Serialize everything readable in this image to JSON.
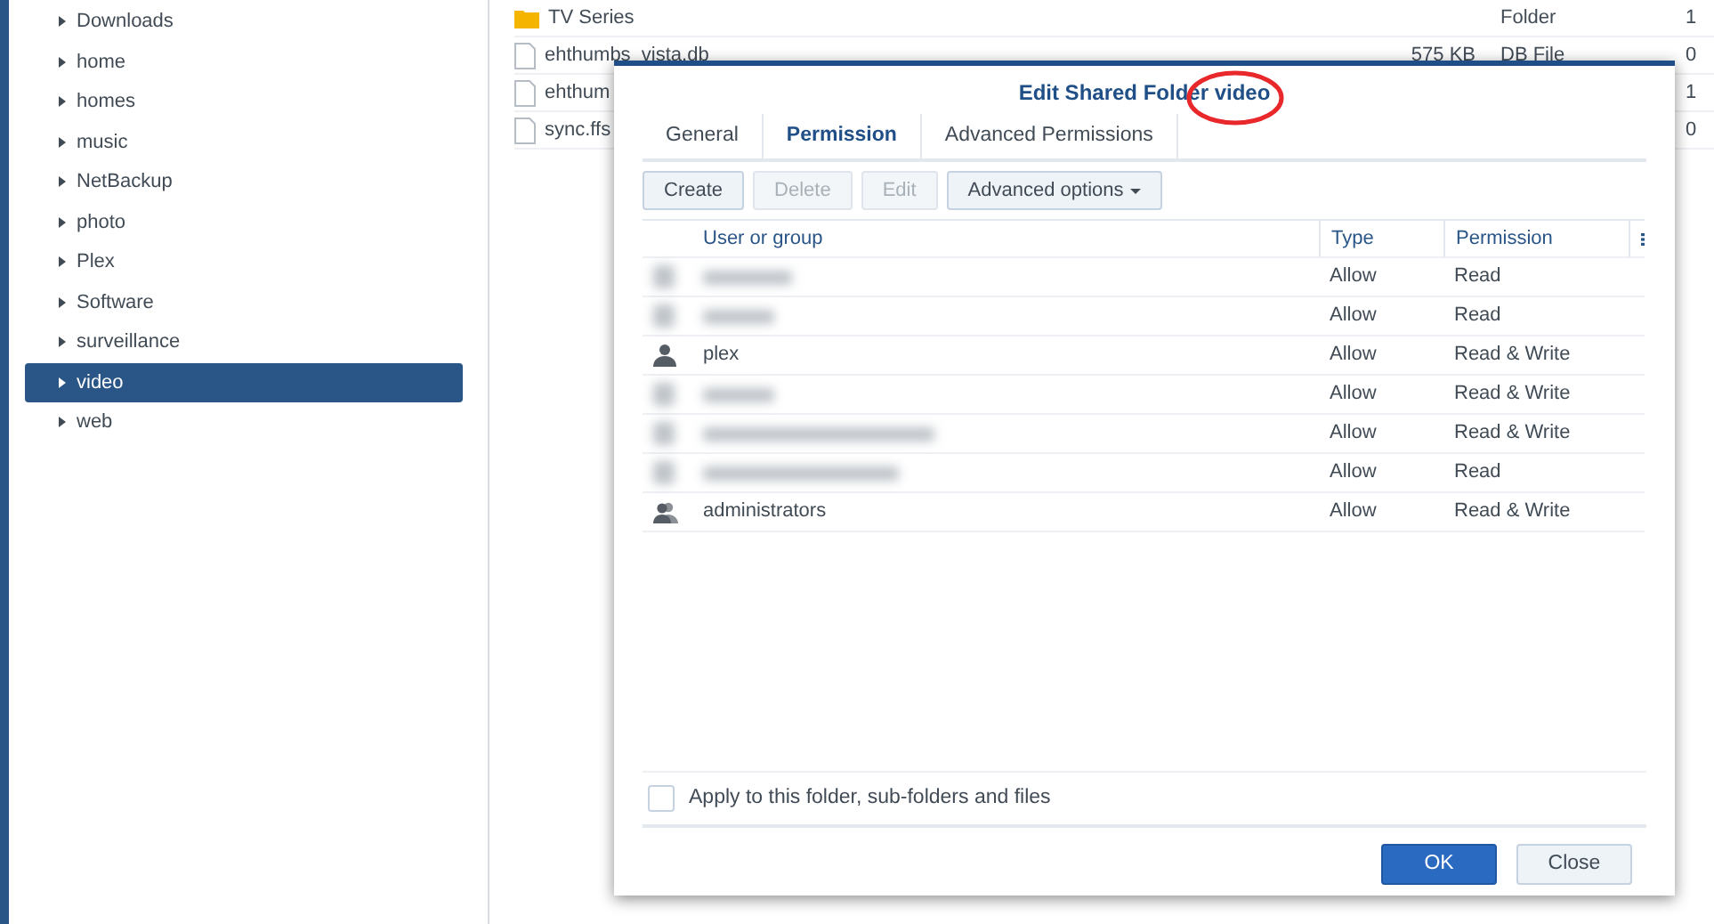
{
  "sidebar": {
    "items": [
      {
        "label": "Downloads",
        "selected": false
      },
      {
        "label": "home",
        "selected": false
      },
      {
        "label": "homes",
        "selected": false
      },
      {
        "label": "music",
        "selected": false
      },
      {
        "label": "NetBackup",
        "selected": false
      },
      {
        "label": "photo",
        "selected": false
      },
      {
        "label": "Plex",
        "selected": false
      },
      {
        "label": "Software",
        "selected": false
      },
      {
        "label": "surveillance",
        "selected": false
      },
      {
        "label": "video",
        "selected": true
      },
      {
        "label": "web",
        "selected": false
      }
    ]
  },
  "files": [
    {
      "kind": "folder",
      "name": "TV Series",
      "type": "Folder",
      "column_4": "1"
    },
    {
      "kind": "file",
      "name": "ehthumbs_vista.db",
      "size": "575 KB",
      "type": "DB File",
      "column_4": "0"
    },
    {
      "kind": "file",
      "name": "ehthum",
      "column_4": "1"
    },
    {
      "kind": "file",
      "name": "sync.ffs",
      "column_4": "0"
    }
  ],
  "dialog": {
    "title": "Edit Shared Folder video",
    "tabs": [
      {
        "label": "General",
        "selected": false
      },
      {
        "label": "Permission",
        "selected": true
      },
      {
        "label": "Advanced Permissions",
        "selected": false
      }
    ],
    "toolbar": [
      {
        "label": "Create",
        "disabled": false,
        "kind": "button"
      },
      {
        "label": "Delete",
        "disabled": true,
        "kind": "button"
      },
      {
        "label": "Edit",
        "disabled": true,
        "kind": "button"
      },
      {
        "label": "Advanced options",
        "disabled": false,
        "kind": "dropdown"
      }
    ],
    "table": {
      "columns": [
        "User or group",
        "Type",
        "Permission"
      ],
      "rows": [
        {
          "kind": "redacted",
          "type": "Allow",
          "permission": "Read"
        },
        {
          "kind": "redacted",
          "type": "Allow",
          "permission": "Read"
        },
        {
          "kind": "user",
          "name": "plex",
          "type": "Allow",
          "permission": "Read & Write"
        },
        {
          "kind": "redacted",
          "type": "Allow",
          "permission": "Read & Write"
        },
        {
          "kind": "redacted",
          "type": "Allow",
          "permission": "Read & Write"
        },
        {
          "kind": "redacted",
          "type": "Allow",
          "permission": "Read"
        },
        {
          "kind": "group",
          "name": "administrators",
          "type": "Allow",
          "permission": "Read & Write"
        }
      ]
    },
    "apply_checkbox": {
      "label": "Apply to this folder, sub-folders and files",
      "checked": false
    },
    "buttons": [
      {
        "label": "OK",
        "kind": "primary"
      },
      {
        "label": "Close",
        "kind": "secondary"
      }
    ]
  }
}
